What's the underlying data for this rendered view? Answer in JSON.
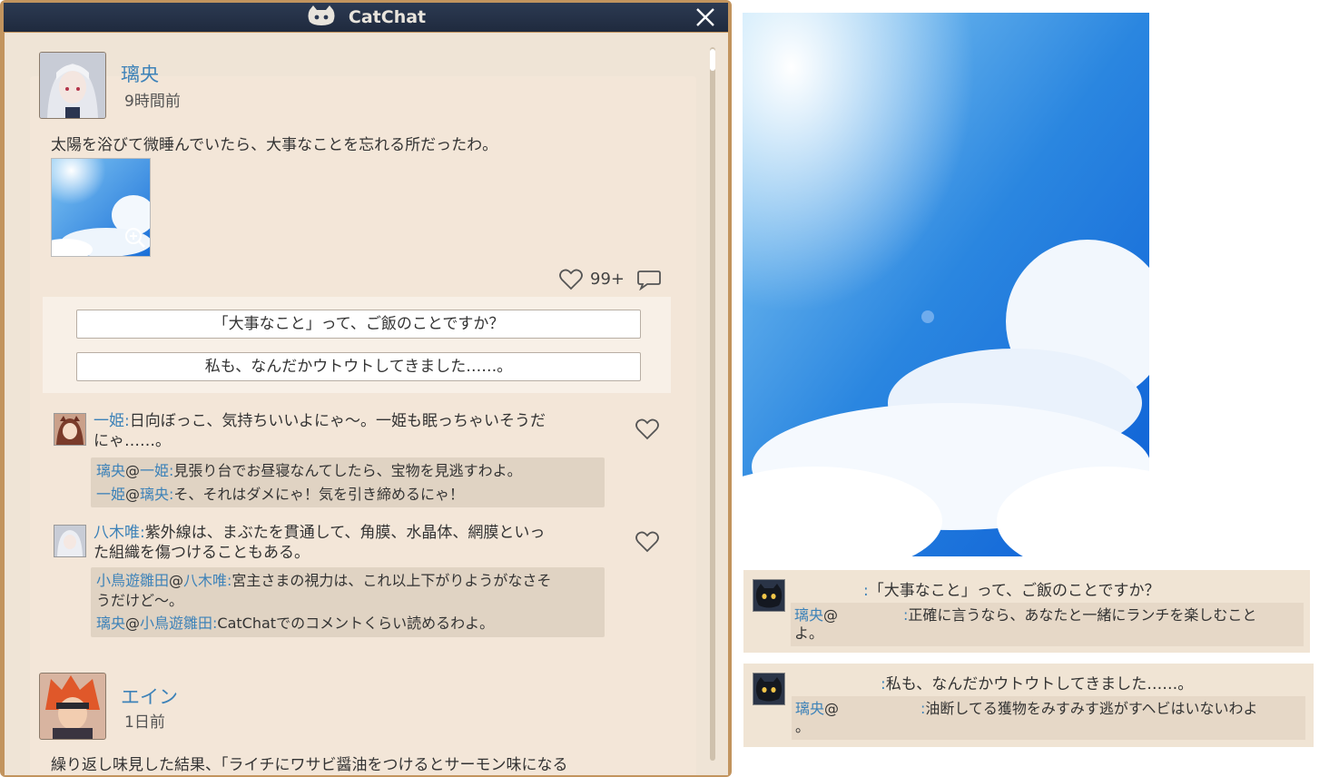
{
  "app": {
    "title": "CatChat"
  },
  "post1": {
    "author": "璃央",
    "time": "9時間前",
    "text": "太陽を浴びて微睡んでいたら、大事なことを忘れる所だったわ。",
    "likes": "99+",
    "reply_options": [
      "「大事なこと」って、ご飯のことですか？",
      "私も、なんだかウトウトしてきました……。"
    ],
    "comments": [
      {
        "user": "一姫:",
        "text_line1": "日向ぼっこ、気持ちいいよにゃ～。一姫も眠っちゃいそうだ",
        "text_line2": "にゃ……。",
        "replies": [
          {
            "from": "璃央",
            "at": "@",
            "to": "一姫:",
            "text": "見張り台でお昼寝なんてしたら、宝物を見逃すわよ。"
          },
          {
            "from": "一姫",
            "at": "@",
            "to": "璃央:",
            "text": "そ、それはダメにゃ！気を引き締めるにゃ！"
          }
        ]
      },
      {
        "user": "八木唯:",
        "text_line1": "紫外線は、まぶたを貫通して、角膜、水晶体、網膜といっ",
        "text_line2": "た組織を傷つけることもある。",
        "replies": [
          {
            "from": "小鳥遊雛田",
            "at": "@",
            "to": "八木唯:",
            "text": "宮主さまの視力は、これ以上下がりようがなさそ",
            "text2": "うだけど～。"
          },
          {
            "from": "璃央",
            "at": "@",
            "to": "小鳥遊雛田:",
            "text": "CatChatでのコメントくらい読めるわよ。"
          }
        ]
      }
    ]
  },
  "post2": {
    "author": "エイン",
    "time": "1日前",
    "text": "繰り返し味見した結果、「ライチにワサビ醤油をつけるとサーモン味になる"
  },
  "side": {
    "panel1": {
      "colon": ":",
      "text": "「大事なこと」って、ご飯のことですか？",
      "reply_from": "璃央",
      "reply_at": "@",
      "reply_colon": ":",
      "reply_text": "正確に言うなら、あなたと一緒にランチを楽しむこと",
      "reply_text2": "よ。"
    },
    "panel2": {
      "colon": ":",
      "text": "私も、なんだかウトウトしてきました……。",
      "reply_from": "璃央",
      "reply_at": "@",
      "reply_colon": ":",
      "reply_text": "油断してる獲物をみすみす逃がすヘビはいないわよ",
      "reply_text2": "。"
    }
  },
  "colors": {
    "accent": "#3d82b8",
    "titlebar": "#1f2a3e",
    "frame": "#c2945e",
    "background": "#efe4d6"
  }
}
